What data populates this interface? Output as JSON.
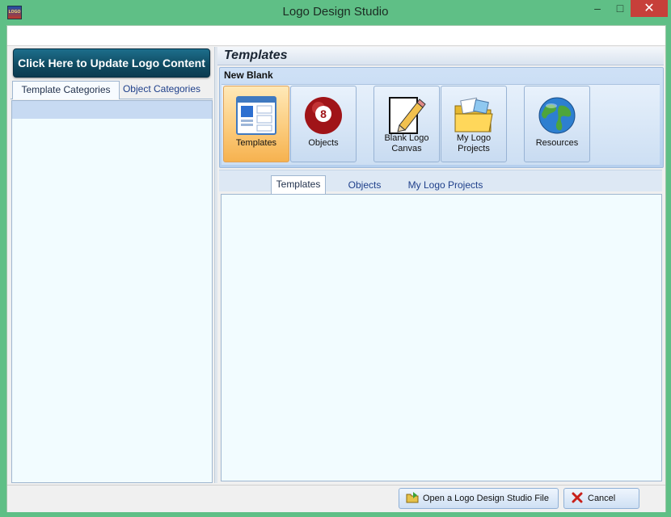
{
  "window": {
    "title": "Logo Design Studio",
    "app_icon": "logo-icon",
    "minimize_glyph": "–",
    "maximize_glyph": "□",
    "close_glyph": "✕"
  },
  "left": {
    "update_button": "Click Here to Update Logo Content",
    "tabs": [
      {
        "label": "Template Categories",
        "active": true
      },
      {
        "label": "Object Categories",
        "active": false
      }
    ]
  },
  "ribbon": {
    "title": "Templates",
    "group": "New Blank",
    "buttons": [
      {
        "label": "Templates",
        "icon": "templates-icon",
        "selected": true
      },
      {
        "label": "Objects",
        "icon": "eight-ball-icon",
        "selected": false
      },
      {
        "label_line1": "Blank Logo",
        "label_line2": "Canvas",
        "icon": "pencil-paper-icon",
        "selected": false
      },
      {
        "label_line1": "My Logo",
        "label_line2": "Projects",
        "icon": "folder-icon",
        "selected": false
      },
      {
        "label": "Resources",
        "icon": "globe-icon",
        "selected": false
      }
    ]
  },
  "content_tabs": [
    {
      "label": "Templates",
      "active": true
    },
    {
      "label": "Objects",
      "active": false
    },
    {
      "label": "My Logo Projects",
      "active": false
    }
  ],
  "footer": {
    "open_button": "Open a Logo Design Studio File",
    "cancel_button": "Cancel"
  },
  "colors": {
    "window_frame": "#5fbf86",
    "accent_button": "#0f4960",
    "selected_ribbon": "#fbc978",
    "close_red": "#c7403a"
  }
}
